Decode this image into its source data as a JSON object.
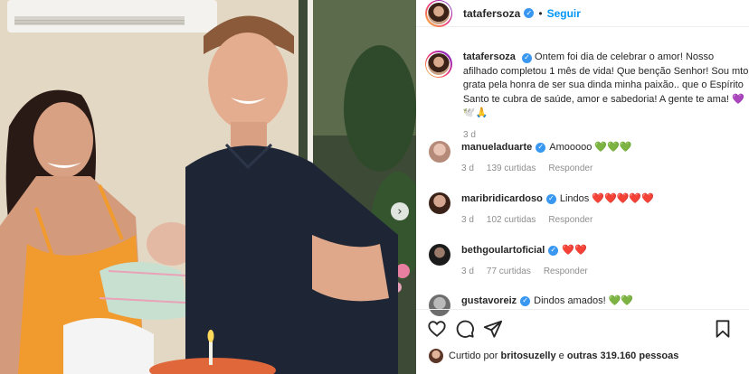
{
  "post": {
    "author": "tatafersoza",
    "follow_label": "Seguir",
    "separator": "•",
    "caption": "Ontem foi dia de celebrar o amor! Nosso afilhado completou 1 mês de vida! Que benção Senhor! Sou mto grata pela honra de ser sua dinda minha paixão.. que o Espírito Santo te cubra de saúde, amor e sabedoria! A gente te ama! 💜🕊️🙏",
    "time": "3 d"
  },
  "comments": [
    {
      "user": "manueladuarte",
      "text": "Amooooo 💚💚💚",
      "time": "3 d",
      "likes": "139 curtidas",
      "reply": "Responder",
      "avatar_color": "#d9b3a3"
    },
    {
      "user": "maribridicardoso",
      "text": "Lindos ❤️❤️❤️❤️❤️",
      "time": "3 d",
      "likes": "102 curtidas",
      "reply": "Responder",
      "avatar_color": "#7a4a3a"
    },
    {
      "user": "bethgoulartoficial",
      "text": "❤️❤️",
      "time": "3 d",
      "likes": "77 curtidas",
      "reply": "Responder",
      "avatar_color": "#2b2b2b"
    },
    {
      "user": "gustavoreiz",
      "text": "Dindos amados! 💚💚",
      "time": "",
      "likes": "",
      "reply": "",
      "avatar_color": "#8a8a8a"
    }
  ],
  "likes": {
    "prefix": "Curtido por",
    "user": "britosuzelly",
    "connector": "e",
    "others": "outras 319.160 pessoas"
  },
  "icons": {
    "like": "heart-icon",
    "comment": "comment-icon",
    "share": "share-icon",
    "save": "bookmark-icon",
    "carousel": "chevron-right-icon",
    "verified": "verified-badge-icon"
  },
  "colors": {
    "accent": "#0095f6",
    "verified": "#3897f0",
    "muted": "#8e8e8e",
    "text": "#262626"
  }
}
